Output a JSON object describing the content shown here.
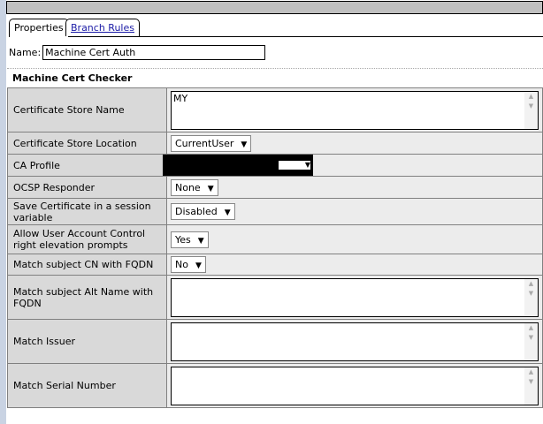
{
  "tabs": [
    {
      "label": "Properties"
    },
    {
      "label": "Branch Rules"
    }
  ],
  "name": {
    "label": "Name:",
    "value": "Machine Cert Auth"
  },
  "section_title": "Machine Cert Checker",
  "rows": {
    "store_name": {
      "label": "Certificate Store Name",
      "value": "MY"
    },
    "store_location": {
      "label": "Certificate Store Location",
      "value": "CurrentUser"
    },
    "ca_profile": {
      "label": "CA Profile"
    },
    "ocsp": {
      "label": "OCSP Responder",
      "value": "None"
    },
    "save_cert": {
      "label": "Save Certificate in a session variable",
      "value": "Disabled"
    },
    "uac": {
      "label": "Allow User Account Control right elevation prompts",
      "value": "Yes"
    },
    "match_cn": {
      "label": "Match subject CN with FQDN",
      "value": "No"
    },
    "match_alt": {
      "label": "Match subject Alt Name with FQDN",
      "value": ""
    },
    "match_issuer": {
      "label": "Match Issuer",
      "value": ""
    },
    "match_serial": {
      "label": "Match Serial Number",
      "value": ""
    }
  }
}
